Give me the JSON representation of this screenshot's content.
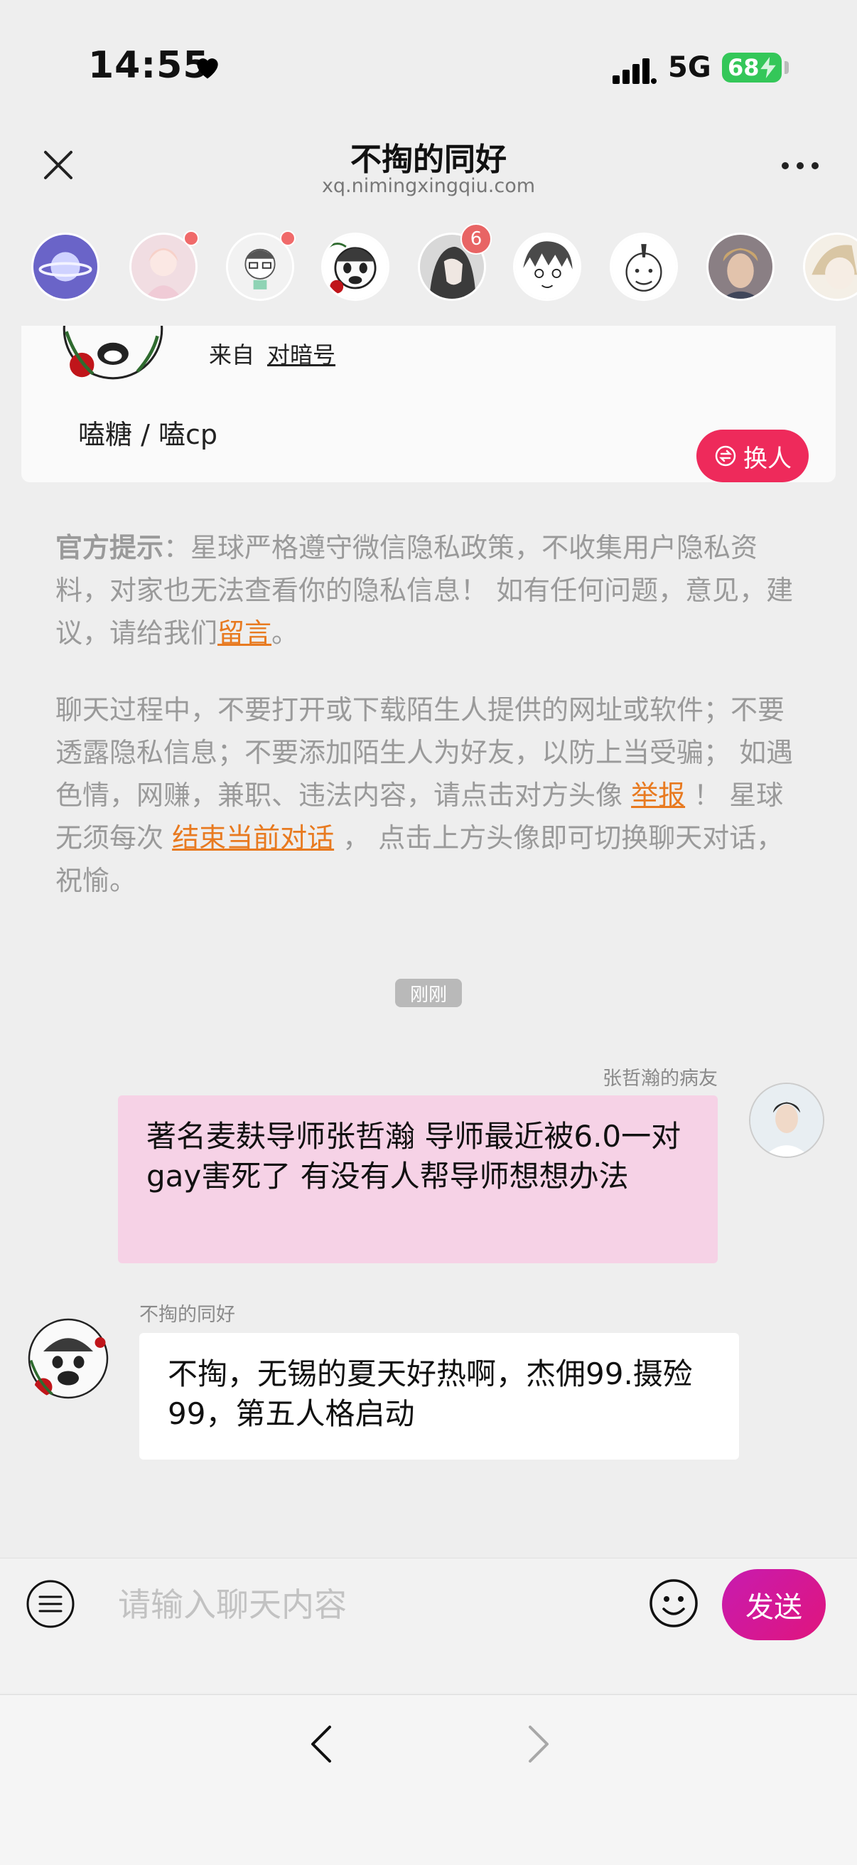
{
  "status_bar": {
    "time": "14:55",
    "network": "5G",
    "battery": "68"
  },
  "header": {
    "title": "不掏的同好",
    "subtitle": "xq.nimingxingqiu.com"
  },
  "avatars": [
    {
      "name": "planet-icon"
    },
    {
      "name": "girl",
      "unread_dot": true
    },
    {
      "name": "boy-glasses",
      "unread_dot": true
    },
    {
      "name": "manga-face-active"
    },
    {
      "name": "dark-hair",
      "badge": "6"
    },
    {
      "name": "anime-sketch"
    },
    {
      "name": "cartoon-man"
    },
    {
      "name": "blonde-man"
    },
    {
      "name": "partial"
    }
  ],
  "profile": {
    "from_label": "来自",
    "from_link": "对暗号",
    "interest": "嗑糖 / 嗑cp",
    "swap_label": "换人"
  },
  "notice1": {
    "bold": "官方提示",
    "text": "：星球严格遵守微信隐私政策，不收集用户隐私资料，对家也无法查看你的隐私信息！ 如有任何问题，意见，建议，请给我们",
    "link": "留言",
    "end": "。"
  },
  "notice2": {
    "part1": "聊天过程中，不要打开或下载陌生人提供的网址或软件；不要透露隐私信息；不要添加陌生人为好友，以防上当受骗； 如遇色情，网赚，兼职、违法内容，请点击对方头像 ",
    "report_link": "举报",
    "part2": " ！ 星球无须每次 ",
    "end_link": "结束当前对话",
    "part3": " ， 点击上方头像即可切换聊天对话，祝愉。"
  },
  "time_label": "刚刚",
  "messages": [
    {
      "sender": "张哲瀚的病友",
      "text": "著名麦麸导师张哲瀚 导师最近被6.0一对gay害死了 有没有人帮导师想想办法"
    },
    {
      "sender": "不掏的同好",
      "text": "不掏，无锡的夏天好热啊，杰佣99.摄殓99，第五人格启动"
    }
  ],
  "input": {
    "placeholder": "请输入聊天内容",
    "send_label": "发送"
  },
  "colors": {
    "accent": "#ee2a5b",
    "send": "#d01896",
    "link": "#e87a20",
    "outgoing_bubble": "#f6d2e6"
  }
}
